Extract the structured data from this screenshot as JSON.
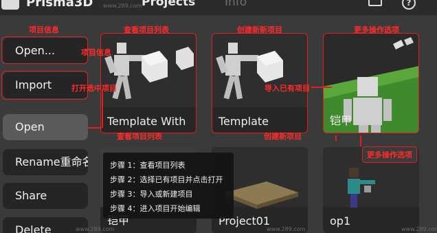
{
  "app": {
    "title": "Prisma3D",
    "tabs": [
      "Projects",
      "Info"
    ]
  },
  "top_icons": {
    "store": "store-icon",
    "help": "help-icon",
    "help_glyph": "?"
  },
  "sidebar": {
    "items": [
      {
        "label": "Open...",
        "selected": false
      },
      {
        "label": "Import",
        "selected": false
      },
      {
        "label": "Open",
        "selected": true
      },
      {
        "label": "Rename重命名",
        "selected": false
      },
      {
        "label": "Share",
        "selected": false
      },
      {
        "label": "Delete",
        "selected": false
      }
    ]
  },
  "cards": [
    {
      "label": "Template With"
    },
    {
      "label": "Template"
    },
    {
      "label": "铠甲"
    },
    {
      "label": "铠甲"
    },
    {
      "label": "Project01"
    },
    {
      "label": "op1"
    }
  ],
  "annotations": {
    "open_info": "项目信息",
    "open_info_side": "项目信息",
    "view_list_top": "查看项目列表",
    "create_new_top": "创建新新项目",
    "more_ops_top": "更多操作选项",
    "open_selected": "打开选中项目",
    "import_existing": "导入已有项目",
    "view_list_bottom": "查看项目列表",
    "create_new_bottom": "创建新项目",
    "more_ops_bottom": "更多操作选项"
  },
  "steps": [
    "步骤 1：查看项目列表",
    "步骤 2：选择已有项目并点击打开",
    "步骤 3：导入或新建项目",
    "步骤 4：进入项目开始编辑"
  ],
  "watermarks": [
    "www.289.com",
    "www.289.com",
    "www.289.com",
    "www.289.com"
  ],
  "colors": {
    "annotation": "#e02020",
    "background": "#3a3a3a",
    "button": "#252525",
    "selected": "#5a5a5a"
  }
}
